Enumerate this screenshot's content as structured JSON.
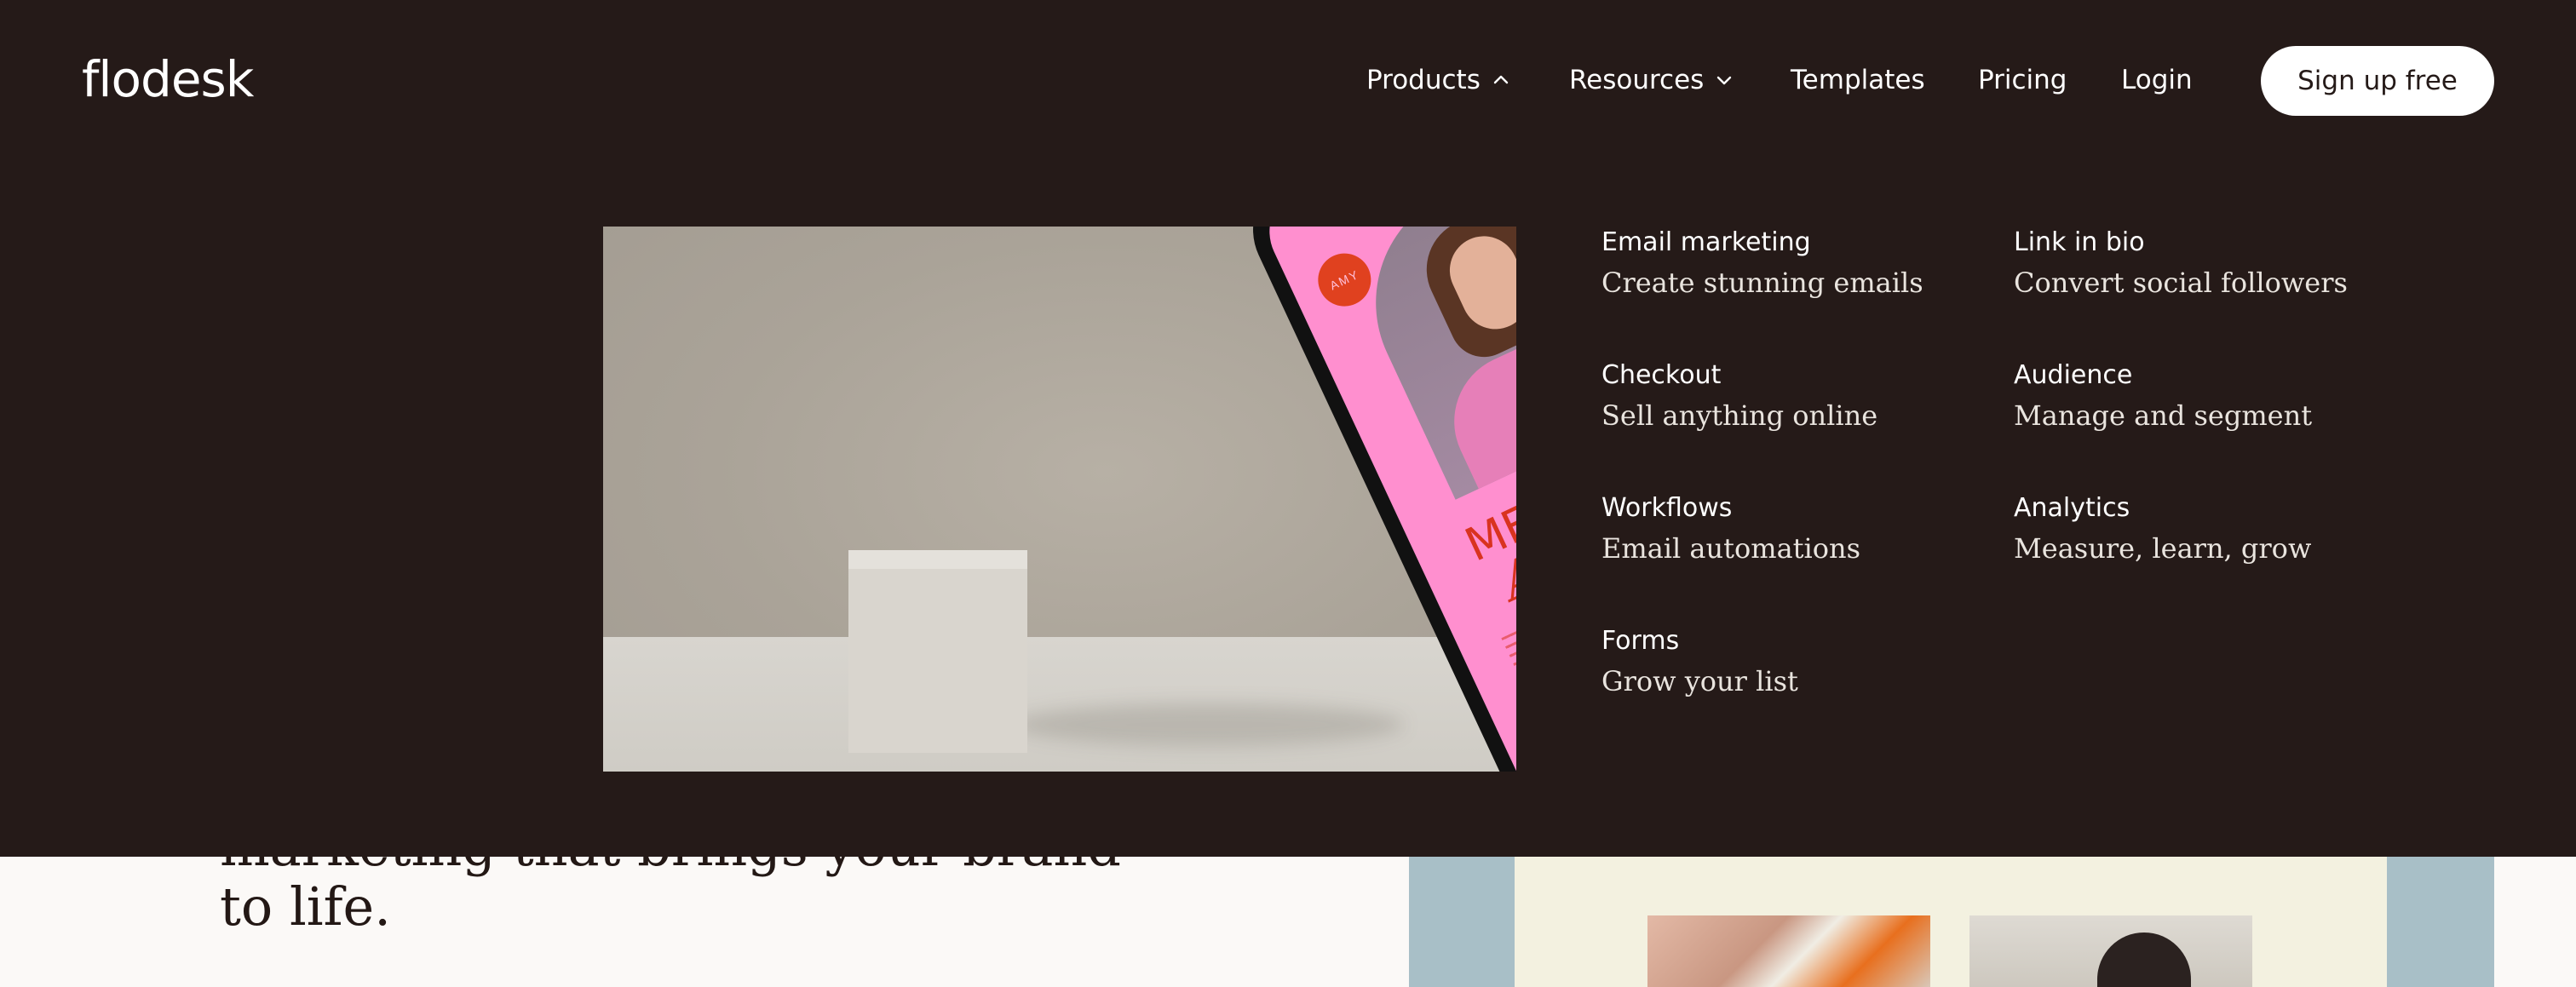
{
  "header": {
    "logo": "flodesk",
    "nav": {
      "products": "Products",
      "resources": "Resources",
      "templates": "Templates",
      "pricing": "Pricing",
      "login": "Login"
    },
    "signup_label": "Sign up free"
  },
  "mega_menu": {
    "products": {
      "left_column": [
        {
          "title": "Email marketing",
          "desc": "Create stunning emails"
        },
        {
          "title": "Checkout",
          "desc": "Sell anything online"
        },
        {
          "title": "Workflows",
          "desc": "Email automations"
        },
        {
          "title": "Forms",
          "desc": "Grow your list"
        }
      ],
      "right_column": [
        {
          "title": "Link in bio",
          "desc": "Convert social followers"
        },
        {
          "title": "Audience",
          "desc": "Manage and segment"
        },
        {
          "title": "Analytics",
          "desc": "Measure, learn, grow"
        }
      ]
    },
    "feature_image": {
      "badge": "AMY",
      "headline_1": "MEET",
      "headline_2": "Amy Keller"
    }
  },
  "hero": {
    "heading_line1": "marketing that brings your brand",
    "heading_line2": "to life."
  },
  "colors": {
    "header_bg": "#251a18",
    "page_bg": "#fbf9f7",
    "accent_pink": "#ff8fcf",
    "accent_red": "#d9331f"
  },
  "icons": {
    "products_chevron": "chevron-up-icon",
    "resources_chevron": "chevron-down-icon"
  }
}
